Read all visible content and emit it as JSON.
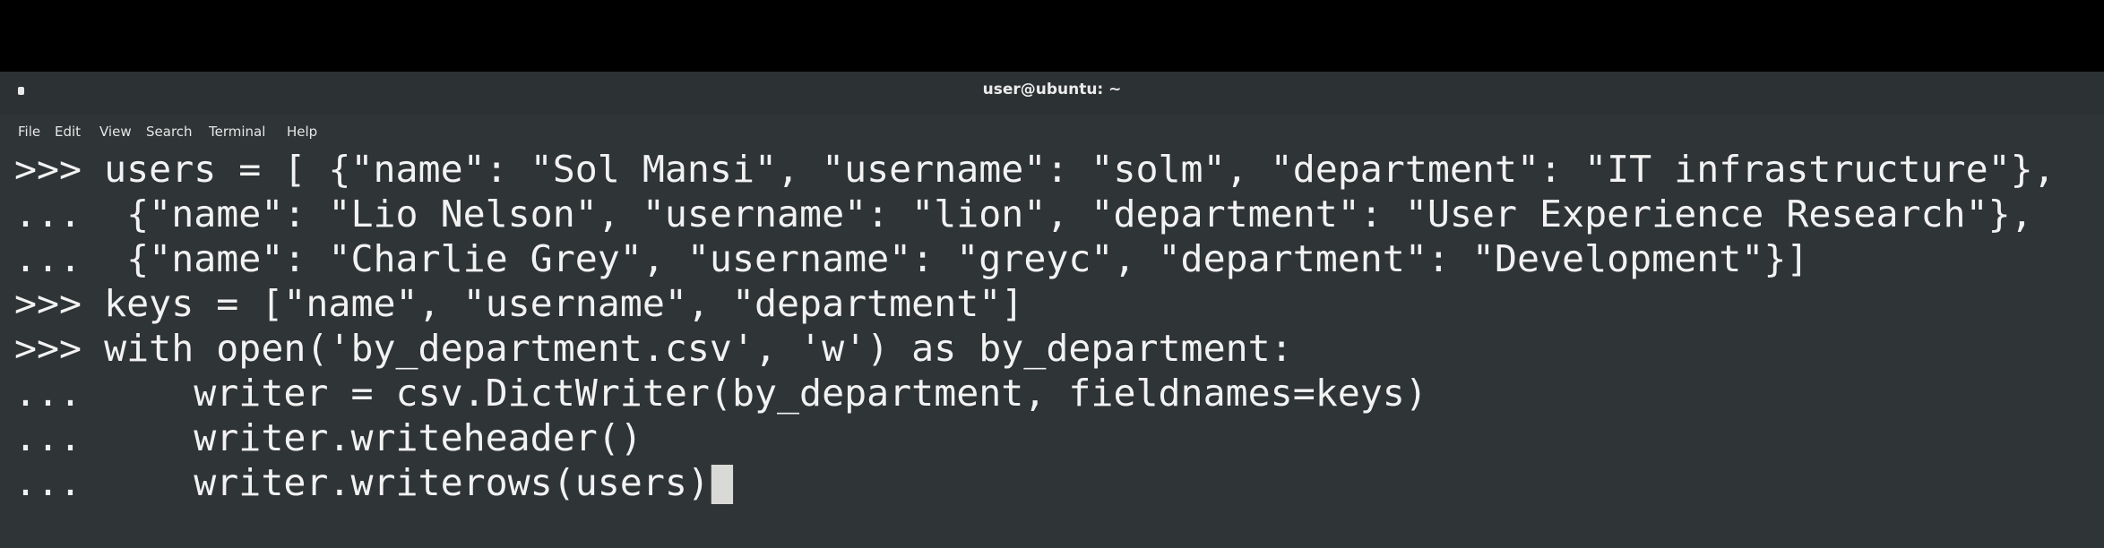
{
  "window": {
    "title": "user@ubuntu: ~"
  },
  "menubar": {
    "items": [
      {
        "label": "File"
      },
      {
        "label": "Edit"
      },
      {
        "label": "View"
      },
      {
        "label": "Search"
      },
      {
        "label": "Terminal"
      },
      {
        "label": "Help"
      }
    ]
  },
  "terminal": {
    "lines": [
      ">>> users = [ {\"name\": \"Sol Mansi\", \"username\": \"solm\", \"department\": \"IT infrastructure\"},",
      "...  {\"name\": \"Lio Nelson\", \"username\": \"lion\", \"department\": \"User Experience Research\"},",
      "...  {\"name\": \"Charlie Grey\", \"username\": \"greyc\", \"department\": \"Development\"}]",
      ">>> keys = [\"name\", \"username\", \"department\"]",
      ">>> with open('by_department.csv', 'w') as by_department:",
      "...     writer = csv.DictWriter(by_department, fieldnames=keys)",
      "...     writer.writeheader()",
      "...     writer.writerows(users)"
    ]
  },
  "colors": {
    "background": "#2f3436",
    "text": "#f2f2f2",
    "cursor": "#d9d9d6",
    "letterbox": "#000000"
  }
}
